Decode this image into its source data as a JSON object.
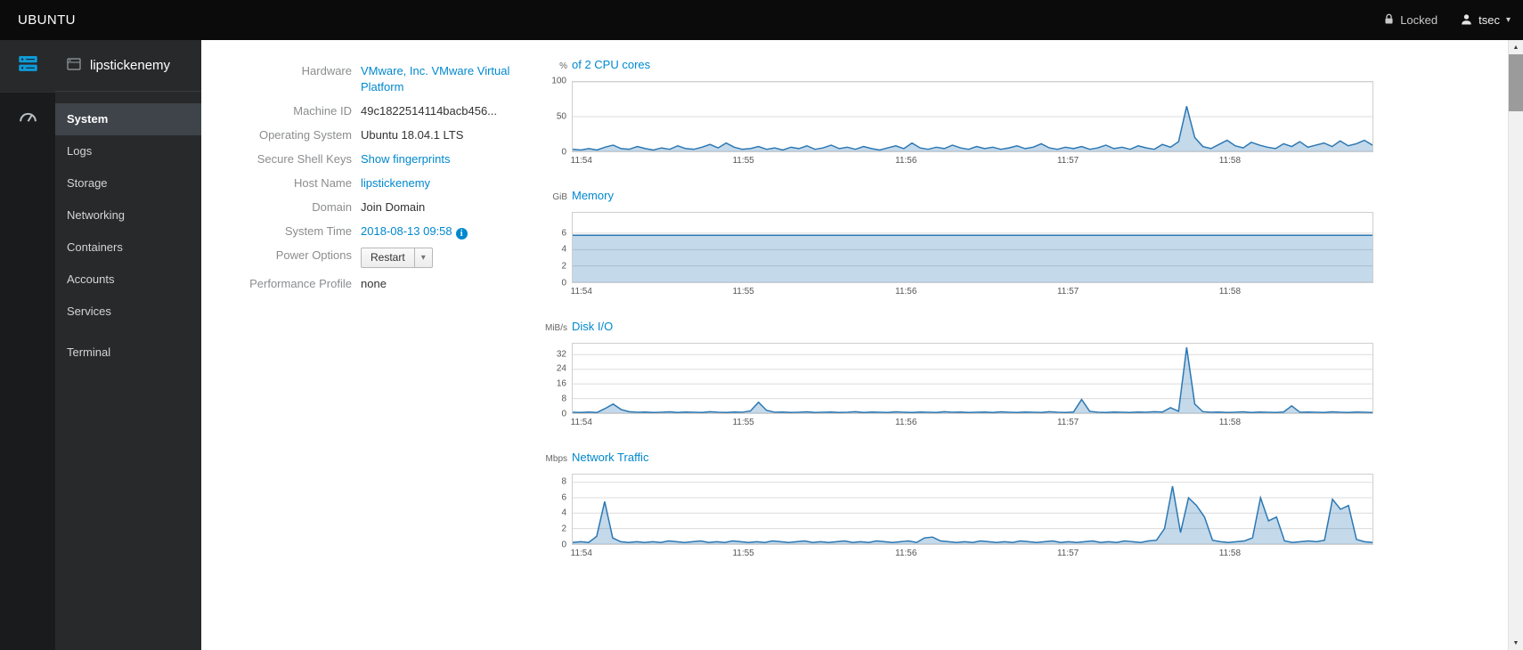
{
  "topbar": {
    "brand": "UBUNTU",
    "locked_label": "Locked",
    "user": "tsec"
  },
  "icons": {
    "caret_down": "▾",
    "scroll_up": "▲",
    "scroll_down": "▼",
    "info": "i"
  },
  "sidebar": {
    "host": "lipstickenemy",
    "items": [
      {
        "label": "System",
        "active": true
      },
      {
        "label": "Logs"
      },
      {
        "label": "Storage"
      },
      {
        "label": "Networking"
      },
      {
        "label": "Containers"
      },
      {
        "label": "Accounts"
      },
      {
        "label": "Services"
      },
      {
        "label": "Terminal"
      }
    ]
  },
  "system": {
    "hardware": {
      "label": "Hardware",
      "value": "VMware, Inc. VMware Virtual Platform"
    },
    "machine_id": {
      "label": "Machine ID",
      "value": "49c1822514114bacb456..."
    },
    "os": {
      "label": "Operating System",
      "value": "Ubuntu 18.04.1 LTS"
    },
    "ssh": {
      "label": "Secure Shell Keys",
      "value": "Show fingerprints"
    },
    "hostname": {
      "label": "Host Name",
      "value": "lipstickenemy"
    },
    "domain": {
      "label": "Domain",
      "value": "Join Domain"
    },
    "time": {
      "label": "System Time",
      "value": "2018-08-13 09:58"
    },
    "power": {
      "label": "Power Options",
      "value": "Restart"
    },
    "profile": {
      "label": "Performance Profile",
      "value": "none"
    }
  },
  "chart_data": [
    {
      "type": "area",
      "title": "of 2 CPU cores",
      "unit": "%",
      "yticks": [
        0,
        50,
        100
      ],
      "ymax": 100,
      "x_labels": [
        "11:54",
        "11:55",
        "11:56",
        "11:57",
        "11:58"
      ],
      "x_positions": [
        0.012,
        0.214,
        0.417,
        0.619,
        0.821
      ],
      "stroke": "#2b77b3",
      "fill": "rgba(43,119,179,0.28)",
      "values": [
        3,
        2,
        4,
        2,
        6,
        9,
        4,
        3,
        7,
        4,
        2,
        5,
        3,
        8,
        4,
        3,
        6,
        10,
        5,
        12,
        6,
        3,
        4,
        7,
        3,
        5,
        2,
        6,
        4,
        8,
        3,
        5,
        9,
        4,
        6,
        3,
        7,
        4,
        2,
        5,
        8,
        4,
        12,
        5,
        3,
        6,
        4,
        9,
        5,
        3,
        7,
        4,
        6,
        3,
        5,
        8,
        4,
        6,
        11,
        5,
        3,
        6,
        4,
        7,
        3,
        5,
        9,
        4,
        6,
        3,
        8,
        5,
        3,
        10,
        6,
        14,
        65,
        20,
        7,
        4,
        10,
        16,
        8,
        5,
        13,
        9,
        6,
        4,
        11,
        7,
        14,
        6,
        9,
        12,
        7,
        15,
        8,
        11,
        16,
        9
      ]
    },
    {
      "type": "area",
      "title": "Memory",
      "unit": "GiB",
      "yticks": [
        0,
        2,
        4,
        6
      ],
      "ymax": 8.5,
      "x_labels": [
        "11:54",
        "11:55",
        "11:56",
        "11:57",
        "11:58"
      ],
      "x_positions": [
        0.012,
        0.214,
        0.417,
        0.619,
        0.821
      ],
      "stroke": "#2b77b3",
      "fill": "rgba(43,119,179,0.28)",
      "values": [
        5.75,
        5.75,
        5.75,
        5.75,
        5.75,
        5.75,
        5.75,
        5.75,
        5.75,
        5.75,
        5.75,
        5.75,
        5.75,
        5.75,
        5.75,
        5.75,
        5.75,
        5.75,
        5.75,
        5.75,
        5.75,
        5.75,
        5.75,
        5.75
      ]
    },
    {
      "type": "area",
      "title": "Disk I/O",
      "unit": "MiB/s",
      "yticks": [
        0,
        8,
        16,
        24,
        32
      ],
      "ymax": 38,
      "x_labels": [
        "11:54",
        "11:55",
        "11:56",
        "11:57",
        "11:58"
      ],
      "x_positions": [
        0.012,
        0.214,
        0.417,
        0.619,
        0.821
      ],
      "stroke": "#2b77b3",
      "fill": "rgba(43,119,179,0.28)",
      "values": [
        0.5,
        0.4,
        0.6,
        0.4,
        2.5,
        5,
        2,
        0.8,
        0.5,
        0.6,
        0.4,
        0.5,
        0.7,
        0.4,
        0.6,
        0.5,
        0.4,
        0.8,
        0.5,
        0.4,
        0.6,
        0.5,
        1.2,
        6,
        1.5,
        0.5,
        0.6,
        0.4,
        0.5,
        0.7,
        0.4,
        0.5,
        0.6,
        0.4,
        0.5,
        0.8,
        0.4,
        0.6,
        0.5,
        0.4,
        0.7,
        0.5,
        0.4,
        0.6,
        0.5,
        0.4,
        0.8,
        0.5,
        0.6,
        0.4,
        0.5,
        0.6,
        0.4,
        0.7,
        0.5,
        0.4,
        0.6,
        0.5,
        0.4,
        0.8,
        0.5,
        0.4,
        0.6,
        7.5,
        1,
        0.5,
        0.4,
        0.6,
        0.5,
        0.4,
        0.6,
        0.5,
        0.8,
        0.6,
        3,
        1,
        36,
        5,
        0.8,
        0.5,
        0.6,
        0.4,
        0.5,
        0.7,
        0.4,
        0.6,
        0.5,
        0.4,
        0.6,
        4,
        0.5,
        0.6,
        0.5,
        0.4,
        0.7,
        0.5,
        0.4,
        0.6,
        0.5,
        0.4
      ]
    },
    {
      "type": "area",
      "title": "Network Traffic",
      "unit": "Mbps",
      "yticks": [
        0,
        2,
        4,
        6,
        8
      ],
      "ymax": 9,
      "x_labels": [
        "11:54",
        "11:55",
        "11:56",
        "11:57",
        "11:58"
      ],
      "x_positions": [
        0.012,
        0.214,
        0.417,
        0.619,
        0.821
      ],
      "stroke": "#2b77b3",
      "fill": "rgba(43,119,179,0.28)",
      "values": [
        0.2,
        0.3,
        0.2,
        1.0,
        5.5,
        0.8,
        0.3,
        0.2,
        0.3,
        0.2,
        0.3,
        0.2,
        0.4,
        0.3,
        0.2,
        0.3,
        0.4,
        0.2,
        0.3,
        0.2,
        0.4,
        0.3,
        0.2,
        0.3,
        0.2,
        0.4,
        0.3,
        0.2,
        0.3,
        0.4,
        0.2,
        0.3,
        0.2,
        0.3,
        0.4,
        0.2,
        0.3,
        0.2,
        0.4,
        0.3,
        0.2,
        0.3,
        0.4,
        0.2,
        0.8,
        0.9,
        0.4,
        0.3,
        0.2,
        0.3,
        0.2,
        0.4,
        0.3,
        0.2,
        0.3,
        0.2,
        0.4,
        0.3,
        0.2,
        0.3,
        0.4,
        0.2,
        0.3,
        0.2,
        0.3,
        0.4,
        0.2,
        0.3,
        0.2,
        0.4,
        0.3,
        0.2,
        0.4,
        0.5,
        2,
        7.5,
        1.5,
        6,
        5,
        3.5,
        0.5,
        0.3,
        0.2,
        0.3,
        0.4,
        0.8,
        6,
        3,
        3.5,
        0.4,
        0.2,
        0.3,
        0.4,
        0.3,
        0.5,
        5.8,
        4.5,
        5,
        0.6,
        0.3,
        0.2
      ]
    }
  ]
}
